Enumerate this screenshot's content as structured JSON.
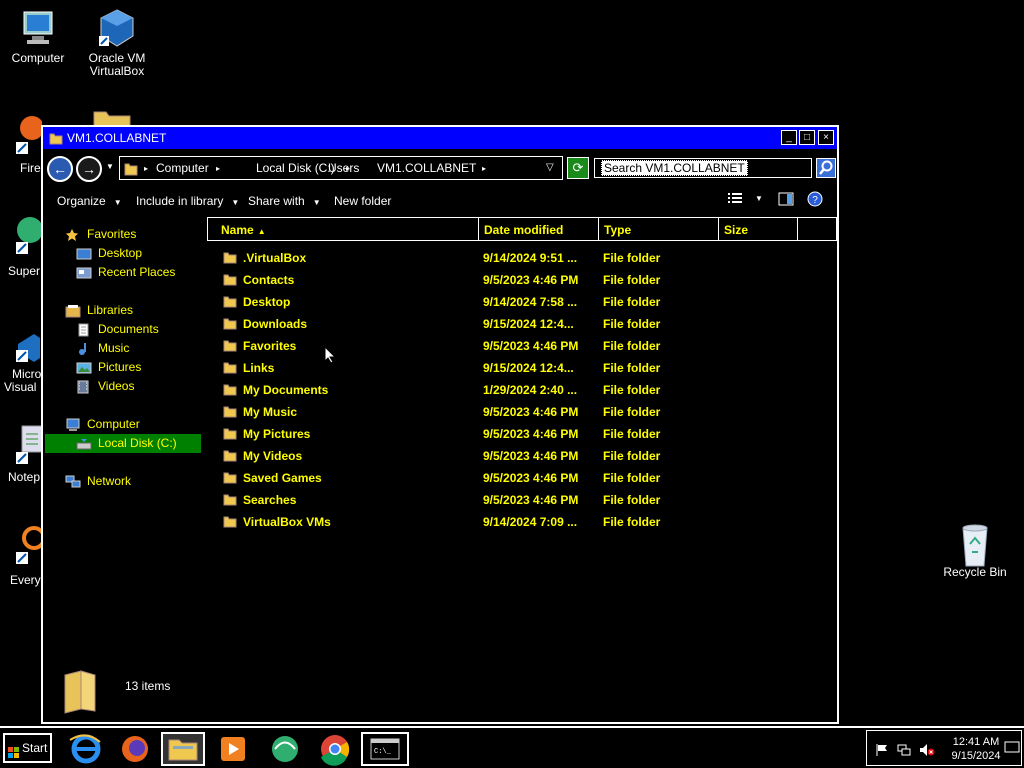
{
  "desktop": {
    "icons": [
      {
        "label": "Computer"
      },
      {
        "label": "Oracle VM VirtualBox"
      },
      {
        "label": "Recycle Bin"
      }
    ],
    "partial_labels": [
      "Fire",
      "Super",
      "Micro",
      "Visual",
      "Notep",
      "Every"
    ]
  },
  "window": {
    "title": "VM1.COLLABNET",
    "controls": {
      "minimize": "_",
      "maximize": "□",
      "close": "×"
    },
    "breadcrumbs": [
      "Computer",
      "Local Disk (C:)",
      "Users",
      "VM1.COLLABNET"
    ],
    "search": {
      "placeholder": "Search VM1.COLLABNET"
    },
    "commands": {
      "organize": "Organize",
      "include_in_library": "Include in library",
      "share_with": "Share with",
      "new_folder": "New folder"
    },
    "nav": {
      "favorites": "Favorites",
      "desktop": "Desktop",
      "recent_places": "Recent Places",
      "libraries": "Libraries",
      "documents": "Documents",
      "music": "Music",
      "pictures": "Pictures",
      "videos": "Videos",
      "computer": "Computer",
      "local_disk": "Local Disk (C:)",
      "network": "Network"
    },
    "columns": {
      "name": "Name",
      "date_modified": "Date modified",
      "type": "Type",
      "size": "Size"
    },
    "files": [
      {
        "name": ".VirtualBox",
        "date": "9/14/2024 9:51 ...",
        "type": "File folder"
      },
      {
        "name": "Contacts",
        "date": "9/5/2023 4:46 PM",
        "type": "File folder"
      },
      {
        "name": "Desktop",
        "date": "9/14/2024 7:58 ...",
        "type": "File folder"
      },
      {
        "name": "Downloads",
        "date": "9/15/2024 12:4...",
        "type": "File folder"
      },
      {
        "name": "Favorites",
        "date": "9/5/2023 4:46 PM",
        "type": "File folder"
      },
      {
        "name": "Links",
        "date": "9/15/2024 12:4...",
        "type": "File folder"
      },
      {
        "name": "My Documents",
        "date": "1/29/2024 2:40 ...",
        "type": "File folder"
      },
      {
        "name": "My Music",
        "date": "9/5/2023 4:46 PM",
        "type": "File folder"
      },
      {
        "name": "My Pictures",
        "date": "9/5/2023 4:46 PM",
        "type": "File folder"
      },
      {
        "name": "My Videos",
        "date": "9/5/2023 4:46 PM",
        "type": "File folder"
      },
      {
        "name": "Saved Games",
        "date": "9/5/2023 4:46 PM",
        "type": "File folder"
      },
      {
        "name": "Searches",
        "date": "9/5/2023 4:46 PM",
        "type": "File folder"
      },
      {
        "name": "VirtualBox VMs",
        "date": "9/14/2024 7:09 ...",
        "type": "File folder"
      }
    ],
    "status": {
      "item_count": "13 items"
    }
  },
  "taskbar": {
    "start_label": "Start",
    "pinned": [
      "internet-explorer-icon",
      "firefox-icon",
      "file-explorer-icon",
      "media-player-icon",
      "app-icon",
      "chrome-icon",
      "command-prompt-icon"
    ],
    "clock": {
      "time": "12:41 AM",
      "date": "9/15/2024"
    }
  },
  "colors": {
    "titlebar": "#0000ff",
    "text_highlight": "#ffff00",
    "selected_bg": "#008000",
    "background": "#000000"
  }
}
